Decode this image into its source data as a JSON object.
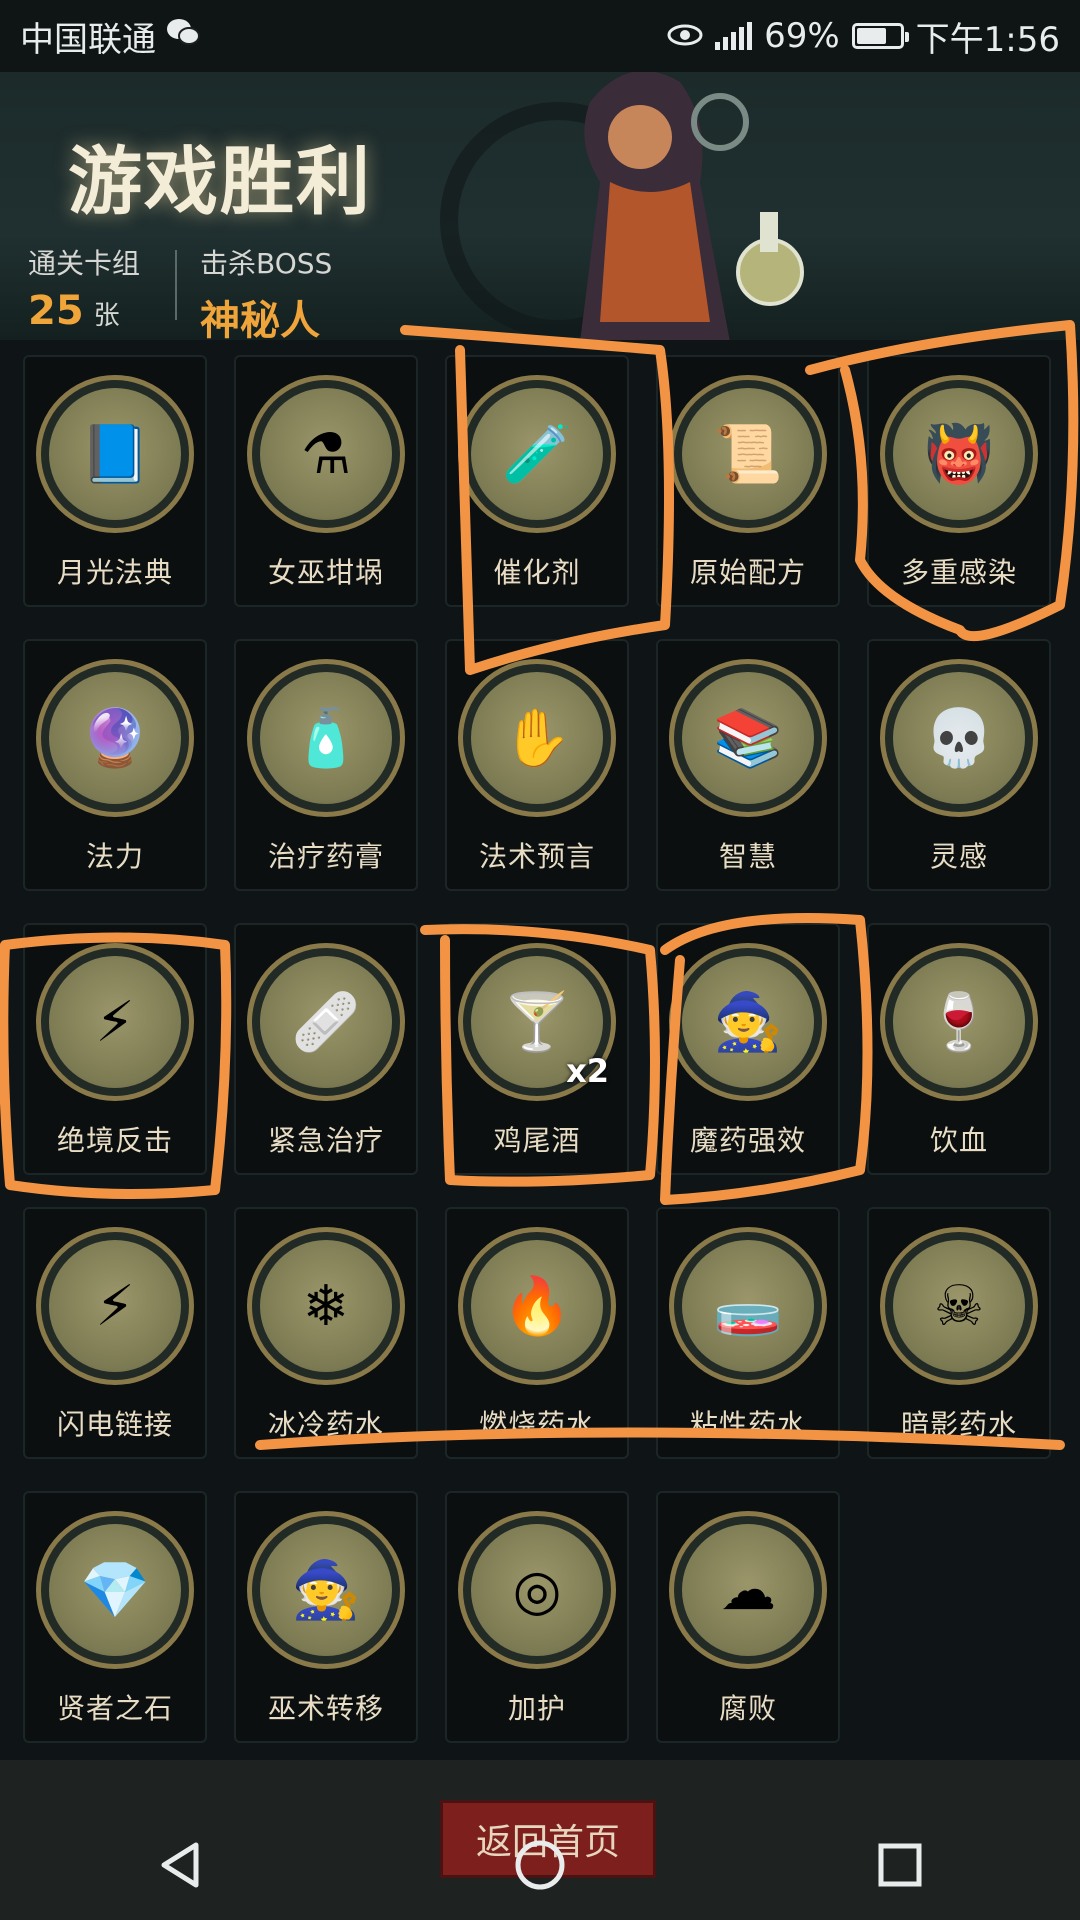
{
  "status_bar": {
    "carrier": "中国联通",
    "battery": "69%",
    "battery_level": 0.69,
    "time": "下午1:56",
    "icons": [
      "wechat-icon",
      "eye-icon",
      "signal-icon",
      "battery-icon"
    ]
  },
  "header": {
    "title": "游戏胜利",
    "deck_label": "通关卡组",
    "deck_count": "25",
    "deck_unit": "张",
    "boss_label": "击杀BOSS",
    "boss_name": "神秘人"
  },
  "cards": [
    {
      "label": "月光法典",
      "icon": "spellbook-icon"
    },
    {
      "label": "女巫坩埚",
      "icon": "cauldron-icon"
    },
    {
      "label": "催化剂",
      "icon": "catalyst-icon"
    },
    {
      "label": "原始配方",
      "icon": "scroll-icon"
    },
    {
      "label": "多重感染",
      "icon": "multi-infection-icon"
    },
    {
      "label": "法力",
      "icon": "mana-orb-icon"
    },
    {
      "label": "治疗药膏",
      "icon": "ointment-icon"
    },
    {
      "label": "法术预言",
      "icon": "prophecy-icon"
    },
    {
      "label": "智慧",
      "icon": "wisdom-icon"
    },
    {
      "label": "灵感",
      "icon": "inspiration-icon"
    },
    {
      "label": "绝境反击",
      "icon": "counterattack-icon"
    },
    {
      "label": "紧急治疗",
      "icon": "first-aid-icon"
    },
    {
      "label": "鸡尾酒",
      "icon": "cocktail-icon",
      "multiplier": "x2"
    },
    {
      "label": "魔药强效",
      "icon": "potion-boost-icon"
    },
    {
      "label": "饮血",
      "icon": "blood-drink-icon"
    },
    {
      "label": "闪电链接",
      "icon": "lightning-icon"
    },
    {
      "label": "冰冷药水",
      "icon": "ice-potion-icon"
    },
    {
      "label": "燃烧药水",
      "icon": "fire-potion-icon"
    },
    {
      "label": "粘性药水",
      "icon": "sticky-potion-icon"
    },
    {
      "label": "暗影药水",
      "icon": "shadow-potion-icon"
    },
    {
      "label": "贤者之石",
      "icon": "philosopher-stone-icon"
    },
    {
      "label": "巫术转移",
      "icon": "wizard-transfer-icon"
    },
    {
      "label": "加护",
      "icon": "shield-ward-icon"
    },
    {
      "label": "腐败",
      "icon": "decay-icon"
    }
  ],
  "footer": {
    "return_button": "返回首页"
  },
  "nav": {
    "back": "back-icon",
    "home": "home-icon",
    "recents": "recents-icon"
  },
  "colors": {
    "accent_orange": "#f0a53b",
    "annotation_orange": "#f39445",
    "button_red": "#7d1f1c"
  }
}
